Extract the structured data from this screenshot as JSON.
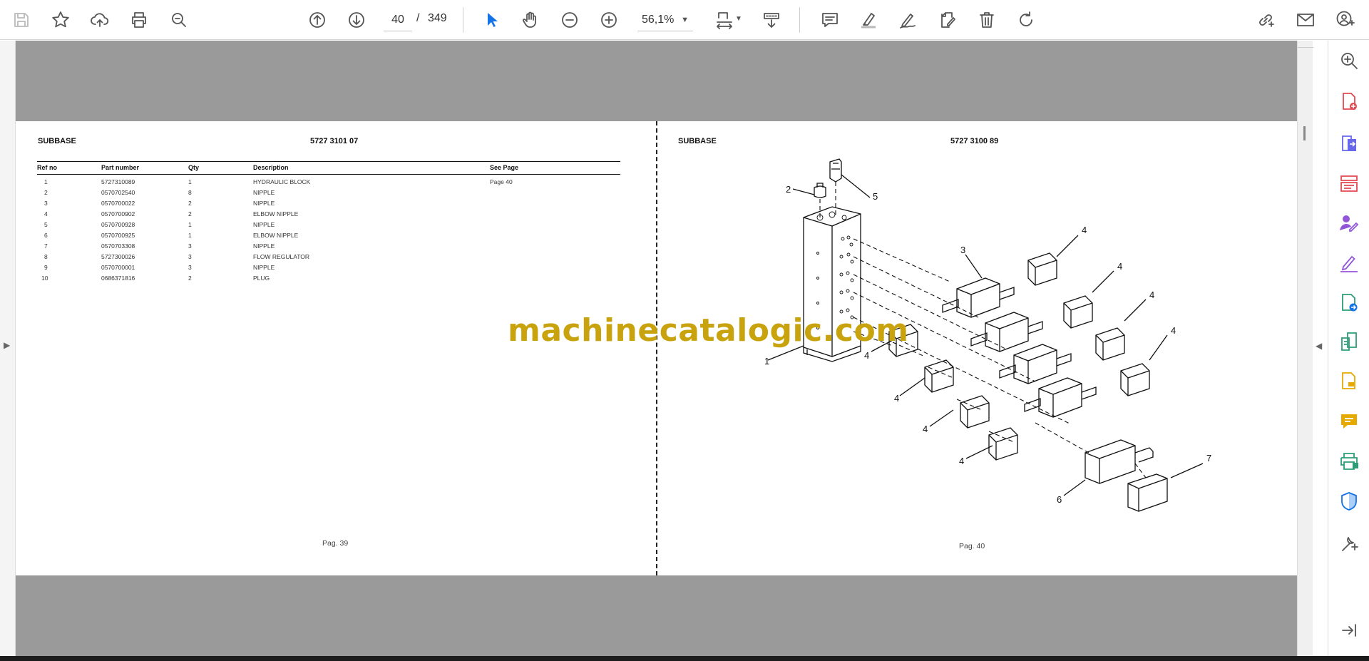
{
  "toolbar": {
    "current_page": "40",
    "page_separator": "/",
    "total_pages": "349",
    "zoom": "56,1%"
  },
  "left_page": {
    "title": "SUBBASE",
    "code": "5727 3101 07",
    "columns": [
      "Ref no",
      "Part number",
      "Qty",
      "Description",
      "See Page"
    ],
    "rows": [
      [
        "1",
        "5727310089",
        "1",
        "HYDRAULIC BLOCK",
        "Page 40"
      ],
      [
        "2",
        "0570702540",
        "8",
        "NIPPLE",
        ""
      ],
      [
        "3",
        "0570700022",
        "2",
        "NIPPLE",
        ""
      ],
      [
        "4",
        "0570700902",
        "2",
        "ELBOW NIPPLE",
        ""
      ],
      [
        "5",
        "0570700928",
        "1",
        "NIPPLE",
        ""
      ],
      [
        "6",
        "0570700925",
        "1",
        "ELBOW NIPPLE",
        ""
      ],
      [
        "7",
        "0570703308",
        "3",
        "NIPPLE",
        ""
      ],
      [
        "8",
        "5727300026",
        "3",
        "FLOW REGULATOR",
        ""
      ],
      [
        "9",
        "0570700001",
        "3",
        "NIPPLE",
        ""
      ],
      [
        "10",
        "0686371816",
        "2",
        "PLUG",
        ""
      ]
    ],
    "page_label": "Pag. 39"
  },
  "right_page": {
    "title": "SUBBASE",
    "code": "5727 3100 89",
    "page_label": "Pag. 40",
    "callouts": [
      "2",
      "5",
      "4",
      "3",
      "4",
      "4",
      "4",
      "1",
      "4",
      "4",
      "4",
      "4",
      "7",
      "6"
    ]
  },
  "watermark": "machinecatalogic.com",
  "icons": {
    "toolbar": [
      "save-icon",
      "star-icon",
      "upload-icon",
      "print-icon",
      "search-icon",
      "page-up-icon",
      "page-down-icon",
      "select-cursor-icon",
      "hand-icon",
      "zoom-out-icon",
      "zoom-in-icon",
      "fit-page-icon",
      "scroll-mode-icon",
      "comment-icon",
      "highlight-icon",
      "draw-icon",
      "edit-text-icon",
      "delete-icon",
      "rotate-icon",
      "share-link-icon",
      "email-icon",
      "user-icon"
    ],
    "right_panel": [
      "zoom-search-icon",
      "create-pdf-icon",
      "export-pdf-icon",
      "organize-pages-icon",
      "request-signature-icon",
      "fill-sign-icon",
      "export-icon",
      "compress-icon",
      "edit-pdf-icon",
      "comment-tool-icon",
      "print-production-icon",
      "protect-icon",
      "more-tools-icon",
      "expand-panel-icon"
    ]
  },
  "colors": {
    "accent_blue": "#1473e6",
    "watermark": "#c9a30e",
    "viewer_bg": "#9a9a9a"
  }
}
